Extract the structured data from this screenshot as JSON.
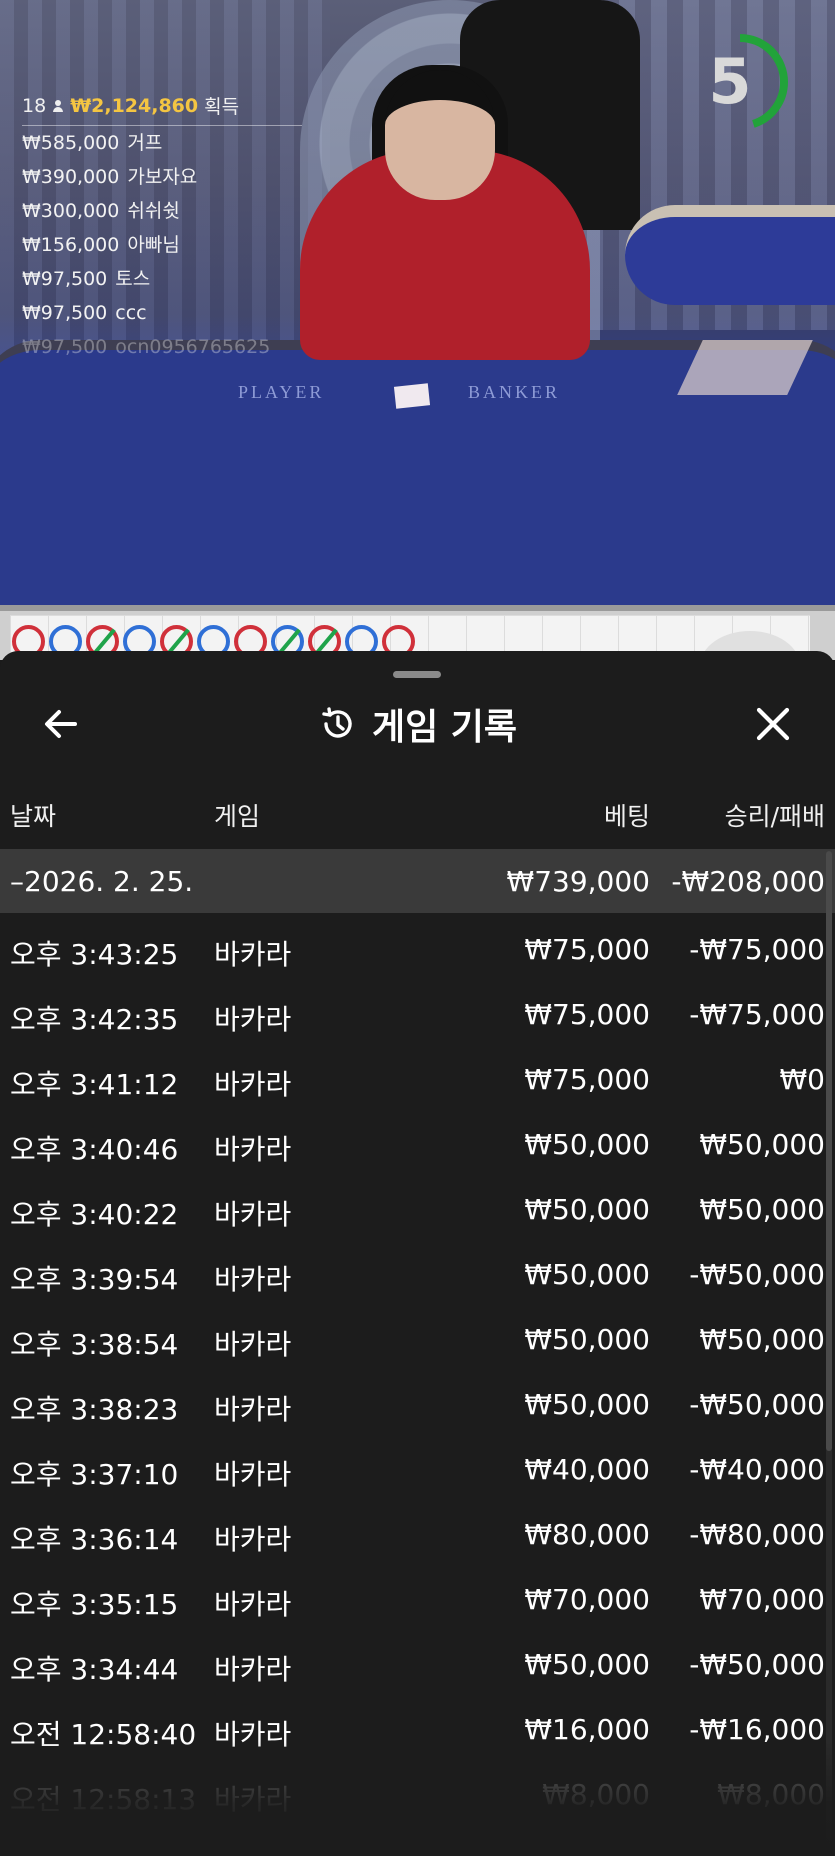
{
  "leaderboard": {
    "players_count": "18",
    "total_won": "₩2,124,860",
    "won_label": "획득",
    "entries": [
      {
        "amount": "₩585,000",
        "name": "거프"
      },
      {
        "amount": "₩390,000",
        "name": "가보자요"
      },
      {
        "amount": "₩300,000",
        "name": "쉬쉬쉿"
      },
      {
        "amount": "₩156,000",
        "name": "아빠님"
      },
      {
        "amount": "₩97,500",
        "name": "토스"
      },
      {
        "amount": "₩97,500",
        "name": "ccc"
      },
      {
        "amount": "₩97,500",
        "name": "ocn0956765625"
      }
    ]
  },
  "stream": {
    "label_player": "PLAYER",
    "label_banker": "BANKER"
  },
  "timer": {
    "seconds": "5",
    "progress": 0.45,
    "color": "#22a33a"
  },
  "roadmap": {
    "beads": [
      "red",
      "blue",
      "tie",
      "blue",
      "tie",
      "blue",
      "red",
      "tie-blue",
      "tie",
      "blue",
      "red"
    ]
  },
  "history": {
    "title": "게임 기록",
    "back_icon": "arrow-left-icon",
    "history_icon": "history-clock-icon",
    "close_icon": "close-icon",
    "columns": {
      "date": "날짜",
      "game": "게임",
      "bet": "베팅",
      "result": "승리/패배"
    },
    "summary": {
      "date": "–2026. 2. 25.",
      "bet": "₩739,000",
      "result": "-₩208,000"
    },
    "rows": [
      {
        "time": "오후 3:43:25",
        "game": "바카라",
        "bet": "₩75,000",
        "result": "-₩75,000"
      },
      {
        "time": "오후 3:42:35",
        "game": "바카라",
        "bet": "₩75,000",
        "result": "-₩75,000"
      },
      {
        "time": "오후 3:41:12",
        "game": "바카라",
        "bet": "₩75,000",
        "result": "₩0"
      },
      {
        "time": "오후 3:40:46",
        "game": "바카라",
        "bet": "₩50,000",
        "result": "₩50,000"
      },
      {
        "time": "오후 3:40:22",
        "game": "바카라",
        "bet": "₩50,000",
        "result": "₩50,000"
      },
      {
        "time": "오후 3:39:54",
        "game": "바카라",
        "bet": "₩50,000",
        "result": "-₩50,000"
      },
      {
        "time": "오후 3:38:54",
        "game": "바카라",
        "bet": "₩50,000",
        "result": "₩50,000"
      },
      {
        "time": "오후 3:38:23",
        "game": "바카라",
        "bet": "₩50,000",
        "result": "-₩50,000"
      },
      {
        "time": "오후 3:37:10",
        "game": "바카라",
        "bet": "₩40,000",
        "result": "-₩40,000"
      },
      {
        "time": "오후 3:36:14",
        "game": "바카라",
        "bet": "₩80,000",
        "result": "-₩80,000"
      },
      {
        "time": "오후 3:35:15",
        "game": "바카라",
        "bet": "₩70,000",
        "result": "₩70,000"
      },
      {
        "time": "오후 3:34:44",
        "game": "바카라",
        "bet": "₩50,000",
        "result": "-₩50,000"
      },
      {
        "time": "오전 12:58:40",
        "game": "바카라",
        "bet": "₩16,000",
        "result": "-₩16,000"
      },
      {
        "time": "오전 12:58:13",
        "game": "바카라",
        "bet": "₩8,000",
        "result": "₩8,000"
      }
    ]
  }
}
